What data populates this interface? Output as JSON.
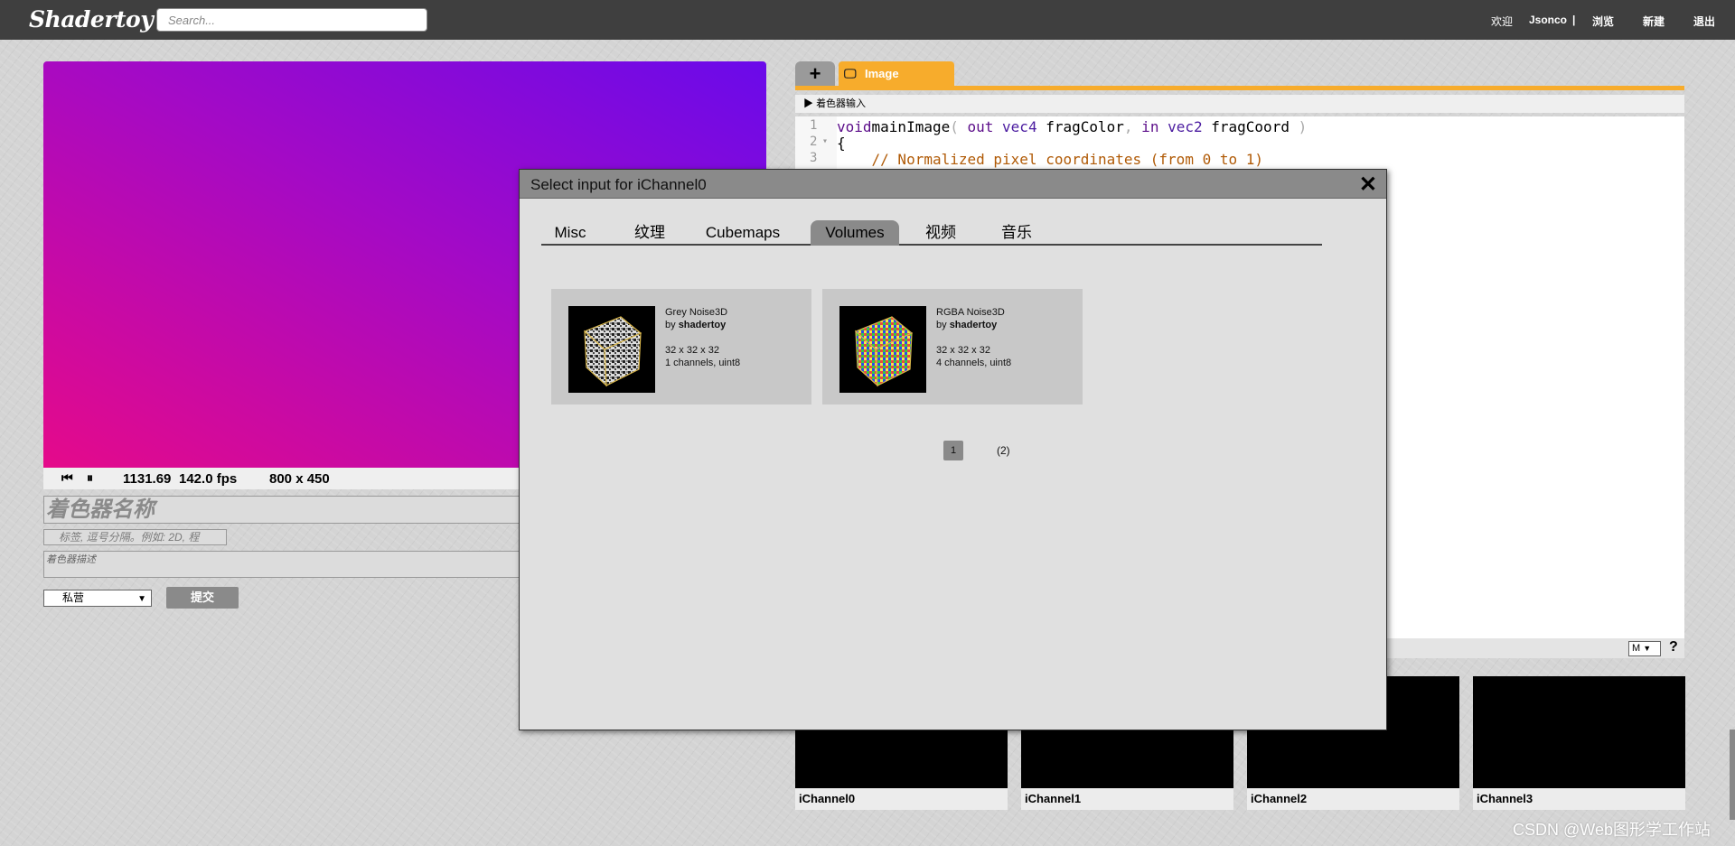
{
  "topbar": {
    "logo": "Shadertoy",
    "search_placeholder": "Search...",
    "welcome": "欢迎",
    "username": "Jsonco",
    "separator": "|",
    "browse": "浏览",
    "new": "新建",
    "logout": "退出"
  },
  "player": {
    "time": "1131.69",
    "fps": "142.0 fps",
    "resolution": "800 x 450"
  },
  "form": {
    "name_placeholder": "着色器名称",
    "tags_placeholder": "标签, 逗号分隔。例如: 2D, 程",
    "description_placeholder": "着色器描述",
    "privacy_value": "私营",
    "submit": "提交"
  },
  "editor": {
    "add_tab": "+",
    "image_tab": "Image",
    "shader_inputs": "着色器输入",
    "lines": [
      {
        "n": "1",
        "fold": "",
        "parts": [
          [
            "kw",
            "void"
          ],
          [
            "",
            "mainImage"
          ],
          [
            "pn",
            "("
          ],
          [
            "",
            ""
          ],
          [
            "kw",
            " out"
          ],
          [
            "ty",
            " vec4"
          ],
          [
            "",
            " fragColor"
          ],
          [
            "pn",
            ","
          ],
          [
            "kw",
            " in"
          ],
          [
            "ty",
            " vec2"
          ],
          [
            "",
            " fragCoord"
          ],
          [
            "pn",
            " )"
          ]
        ]
      },
      {
        "n": "2",
        "fold": "▾",
        "parts": [
          [
            "",
            "{"
          ]
        ]
      },
      {
        "n": "3",
        "fold": "",
        "parts": [
          [
            "cm",
            "    // Normalized pixel coordinates (from 0 to 1)"
          ]
        ]
      }
    ],
    "mode": "M",
    "help": "?"
  },
  "channels": [
    "iChannel0",
    "iChannel1",
    "iChannel2",
    "iChannel3"
  ],
  "modal": {
    "title": "Select input for iChannel0",
    "tabs": [
      "Misc",
      "纹理",
      "Cubemaps",
      "Volumes",
      "视频",
      "音乐"
    ],
    "active_tab": "Volumes",
    "items": [
      {
        "name": "Grey Noise3D",
        "by": "by",
        "author": "shadertoy",
        "size": "32 x 32 x 32",
        "format": "1 channels, uint8"
      },
      {
        "name": "RGBA Noise3D",
        "by": "by",
        "author": "shadertoy",
        "size": "32 x 32 x 32",
        "format": "4 channels, uint8"
      }
    ],
    "pages": [
      "1",
      "(2)"
    ]
  },
  "watermark": "CSDN @Web图形学工作站",
  "colors": {
    "accent": "#f7ac2c",
    "topbar": "#3f3f3f",
    "keyword": "#5c0e8a",
    "comment": "#b05a06"
  }
}
